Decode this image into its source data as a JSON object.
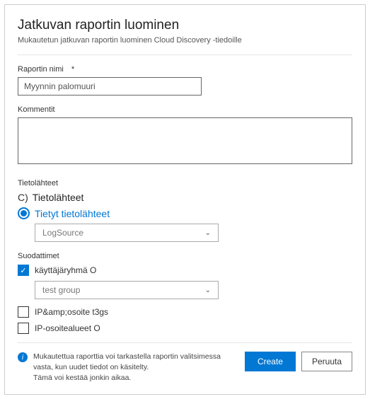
{
  "header": {
    "title": "Jatkuvan raportin luominen",
    "subtitle": "Mukautetun jatkuvan raportin luominen Cloud Discovery -tiedoille"
  },
  "fields": {
    "name_label": "Raportin nimi",
    "required": "*",
    "name_value": "Myynnin palomuuri",
    "comment_label": "Kommentit",
    "comment_value": ""
  },
  "sources": {
    "label": "Tietolähteet",
    "option_all": "Tietolähteet",
    "option_all_prefix": "C)",
    "option_specific": "Tietyt tietolähteet",
    "select_value": "LogSource"
  },
  "filters": {
    "label": "Suodattimet",
    "user_group": "käyttäjäryhmä O",
    "user_group_select": "test group",
    "ip_tags": "IP&amp;osoite t3gs",
    "ip_ranges": "IP-osoitealueet O"
  },
  "footer": {
    "info_line1": "Mukautettua raporttia voi tarkastella raportin valitsimessa vasta, kun uudet tiedot on käsitelty.",
    "info_line2": "Tämä voi kestää jonkin aikaa.",
    "create": "Create",
    "cancel": "Peruuta"
  }
}
